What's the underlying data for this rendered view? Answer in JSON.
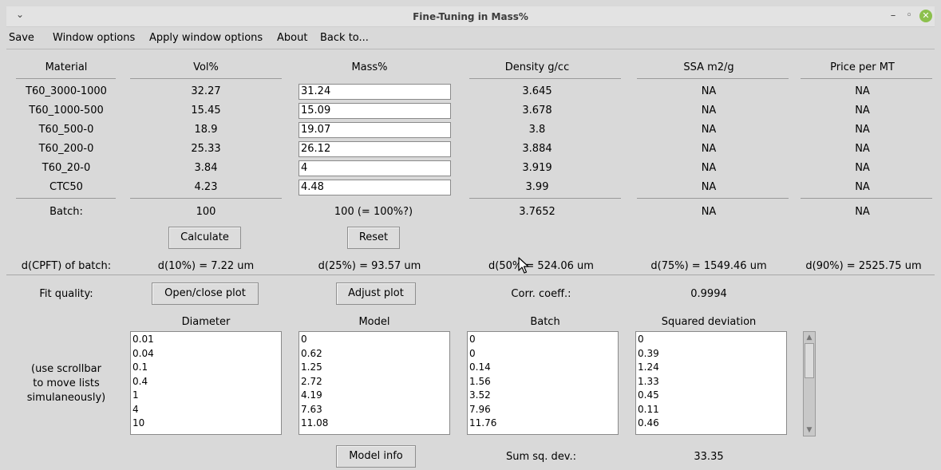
{
  "window": {
    "title": "Fine-Tuning in Mass%",
    "menu_glyph": "⌄",
    "minimize_glyph": "–",
    "maximize_glyph": "◦",
    "close_glyph": "✕"
  },
  "menubar": [
    "Save",
    "Window options",
    "Apply window options",
    "About",
    "Back to..."
  ],
  "headers": {
    "material": "Material",
    "vol": "Vol%",
    "mass": "Mass%",
    "density": "Density g/cc",
    "ssa": "SSA m2/g",
    "price": "Price per MT"
  },
  "rows": [
    {
      "material": "T60_3000-1000",
      "vol": "32.27",
      "mass": "31.24",
      "density": "3.645",
      "ssa": "NA",
      "price": "NA"
    },
    {
      "material": "T60_1000-500",
      "vol": "15.45",
      "mass": "15.09",
      "density": "3.678",
      "ssa": "NA",
      "price": "NA"
    },
    {
      "material": "T60_500-0",
      "vol": "18.9",
      "mass": "19.07",
      "density": "3.8",
      "ssa": "NA",
      "price": "NA"
    },
    {
      "material": "T60_200-0",
      "vol": "25.33",
      "mass": "26.12",
      "density": "3.884",
      "ssa": "NA",
      "price": "NA"
    },
    {
      "material": "T60_20-0",
      "vol": "3.84",
      "mass": "4",
      "density": "3.919",
      "ssa": "NA",
      "price": "NA"
    },
    {
      "material": "CTC50",
      "vol": "4.23",
      "mass": "4.48",
      "density": "3.99",
      "ssa": "NA",
      "price": "NA"
    }
  ],
  "batch": {
    "label": "Batch:",
    "vol": "100",
    "mass": "100 (= 100%?)",
    "density": "3.7652",
    "ssa": "NA",
    "price": "NA"
  },
  "buttons": {
    "calculate": "Calculate",
    "reset": "Reset",
    "open_close_plot": "Open/close plot",
    "adjust_plot": "Adjust plot",
    "model_info": "Model info"
  },
  "dcpft": {
    "label": "d(CPFT) of batch:",
    "d10": "d(10%) = 7.22 um",
    "d25": "d(25%) = 93.57 um",
    "d50": "d(50% = 524.06 um",
    "d75": "d(75%) = 1549.46 um",
    "d90": "d(90%) = 2525.75 um"
  },
  "fit": {
    "label": "Fit quality:",
    "corr_label": "Corr. coeff.:",
    "corr_value": "0.9994"
  },
  "list_headers": {
    "diameter": "Diameter",
    "model": "Model",
    "batch": "Batch",
    "sqdev": "Squared deviation"
  },
  "scroll_note": [
    "(use scrollbar",
    "to move lists",
    "simulaneously)"
  ],
  "lists": {
    "diameter": [
      "0.01",
      "0.04",
      "0.1",
      "0.4",
      "1",
      "4",
      "10"
    ],
    "model": [
      "0",
      "0.62",
      "1.25",
      "2.72",
      "4.19",
      "7.63",
      "11.08"
    ],
    "batch": [
      "0",
      "0",
      "0.14",
      "1.56",
      "3.52",
      "7.96",
      "11.76"
    ],
    "sqdev": [
      "0",
      "0.39",
      "1.24",
      "1.33",
      "0.45",
      "0.11",
      "0.46"
    ]
  },
  "sum": {
    "label": "Sum sq. dev.:",
    "value": "33.35"
  },
  "scrollbar": {
    "up_glyph": "▲",
    "down_glyph": "▼"
  },
  "colors": {
    "background": "#d9d9d9",
    "close_button": "#8cc04d"
  }
}
